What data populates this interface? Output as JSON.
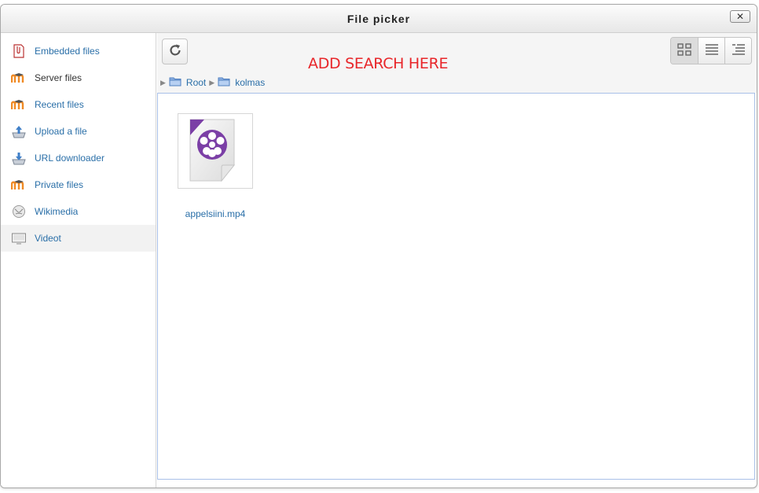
{
  "dialog": {
    "title": "File picker",
    "close_label": "✕"
  },
  "sidebar": {
    "items": [
      {
        "label": "Embedded files",
        "icon": "embedded-files-icon"
      },
      {
        "label": "Server files",
        "icon": "moodle-icon"
      },
      {
        "label": "Recent files",
        "icon": "moodle-icon"
      },
      {
        "label": "Upload a file",
        "icon": "upload-icon"
      },
      {
        "label": "URL downloader",
        "icon": "download-icon"
      },
      {
        "label": "Private files",
        "icon": "moodle-icon"
      },
      {
        "label": "Wikimedia",
        "icon": "wikimedia-icon"
      },
      {
        "label": "Videot",
        "icon": "video-icon"
      }
    ],
    "active": "Videot"
  },
  "toolbar": {
    "search_hint": "ADD SEARCH HERE",
    "views": [
      "icons-view",
      "list-view",
      "tree-view"
    ],
    "active_view": "icons-view"
  },
  "breadcrumb": {
    "items": [
      {
        "label": "Root"
      },
      {
        "label": "kolmas"
      }
    ]
  },
  "files": [
    {
      "name": "appelsiini.mp4",
      "icon": "video-file-icon"
    }
  ],
  "colors": {
    "link": "#2a6fa8",
    "hint": "#e8262a",
    "video_accent": "#7b3fa6"
  }
}
